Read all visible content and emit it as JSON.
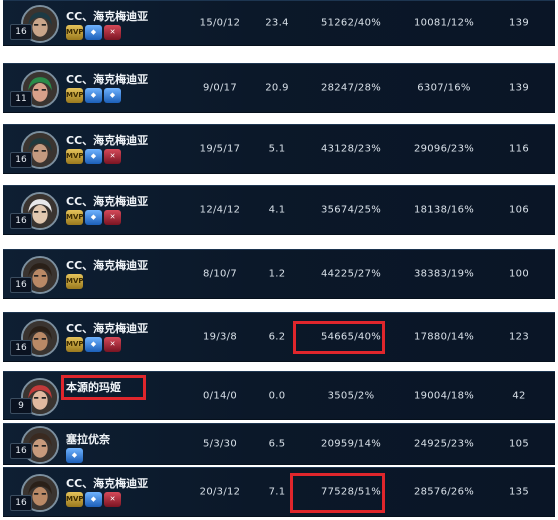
{
  "rows": [
    {
      "name": "CC、海克梅迪亚",
      "level": "16",
      "badges": [
        "MVP",
        "blue",
        "red"
      ],
      "kda": "15/0/12",
      "score": "23.4",
      "damage": "51262/40%",
      "taken": "10081/12%",
      "gold": "139"
    },
    {
      "name": "CC、海克梅迪亚",
      "level": "11",
      "badges": [
        "MVP",
        "blue",
        "blue"
      ],
      "kda": "9/0/17",
      "score": "20.9",
      "damage": "28247/28%",
      "taken": "6307/16%",
      "gold": "139"
    },
    {
      "name": "CC、海克梅迪亚",
      "level": "16",
      "badges": [
        "MVP",
        "blue",
        "red"
      ],
      "kda": "19/5/17",
      "score": "5.1",
      "damage": "43128/23%",
      "taken": "29096/23%",
      "gold": "116"
    },
    {
      "name": "CC、海克梅迪亚",
      "level": "16",
      "badges": [
        "MVP",
        "blue",
        "red"
      ],
      "kda": "12/4/12",
      "score": "4.1",
      "damage": "35674/25%",
      "taken": "18138/16%",
      "gold": "106"
    },
    {
      "name": "CC、海克梅迪亚",
      "level": "16",
      "badges": [
        "MVP"
      ],
      "kda": "8/10/7",
      "score": "1.2",
      "damage": "44225/27%",
      "taken": "38383/19%",
      "gold": "100"
    },
    {
      "name": "CC、海克梅迪亚",
      "level": "16",
      "badges": [
        "MVP",
        "blue",
        "red"
      ],
      "kda": "19/3/8",
      "score": "6.2",
      "damage": "54665/40%",
      "taken": "17880/14%",
      "gold": "123"
    },
    {
      "name": "本源的玛姬",
      "level": "9",
      "badges": [],
      "kda": "0/14/0",
      "score": "0.0",
      "damage": "3505/2%",
      "taken": "19004/18%",
      "gold": "42"
    },
    {
      "name": "塞拉优奈",
      "level": "16",
      "badges": [
        "blue"
      ],
      "kda": "5/3/30",
      "score": "6.5",
      "damage": "20959/14%",
      "taken": "24925/23%",
      "gold": "105"
    },
    {
      "name": "CC、海克梅迪亚",
      "level": "16",
      "badges": [
        "MVP",
        "blue",
        "red"
      ],
      "kda": "20/3/12",
      "score": "7.1",
      "damage": "77528/51%",
      "taken": "28576/26%",
      "gold": "135"
    }
  ],
  "badge_labels": {
    "MVP": "MVP",
    "blue": "◆",
    "red": "✕"
  },
  "colors": {
    "highlight": "#e0262c",
    "row_bg": "#0b1829",
    "text": "#d8e0e8"
  }
}
